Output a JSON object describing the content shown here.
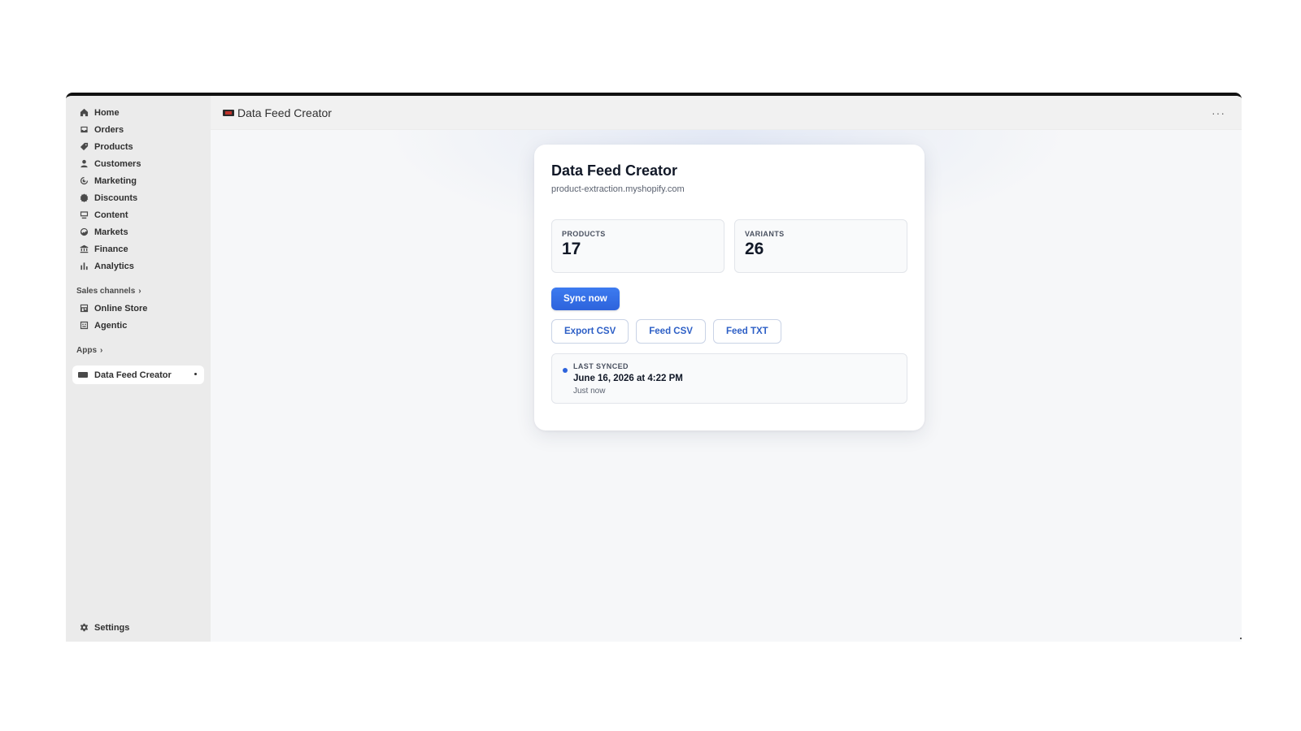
{
  "sidebar": {
    "items": [
      {
        "label": "Home",
        "icon": "home-icon"
      },
      {
        "label": "Orders",
        "icon": "inbox-icon"
      },
      {
        "label": "Products",
        "icon": "tag-icon"
      },
      {
        "label": "Customers",
        "icon": "person-icon"
      },
      {
        "label": "Marketing",
        "icon": "target-icon"
      },
      {
        "label": "Discounts",
        "icon": "discount-icon"
      },
      {
        "label": "Content",
        "icon": "content-icon"
      },
      {
        "label": "Markets",
        "icon": "globe-icon"
      },
      {
        "label": "Finance",
        "icon": "bank-icon"
      },
      {
        "label": "Analytics",
        "icon": "bar-chart-icon"
      }
    ],
    "sales_channels_label": "Sales channels",
    "channels": [
      {
        "label": "Online Store",
        "icon": "store-icon"
      },
      {
        "label": "Agentic",
        "icon": "agent-icon"
      }
    ],
    "apps_label": "Apps",
    "active_app": {
      "label": "Data Feed Creator",
      "icon": "app-icon"
    },
    "settings_label": "Settings"
  },
  "topbar": {
    "title": "Data Feed Creator",
    "more_label": "···"
  },
  "card": {
    "title": "Data Feed Creator",
    "subtitle": "product-extraction.myshopify.com",
    "stats": [
      {
        "label": "PRODUCTS",
        "value": "17"
      },
      {
        "label": "VARIANTS",
        "value": "26"
      }
    ],
    "sync_button": "Sync now",
    "buttons": [
      "Export CSV",
      "Feed CSV",
      "Feed TXT"
    ],
    "status": {
      "label": "LAST SYNCED",
      "date": "June 16, 2026 at 4:22 PM",
      "ago": "Just now"
    }
  },
  "colors": {
    "accent": "#2d63dc",
    "sidebar_bg": "#ebebeb",
    "content_bg": "#f6f7f9"
  }
}
